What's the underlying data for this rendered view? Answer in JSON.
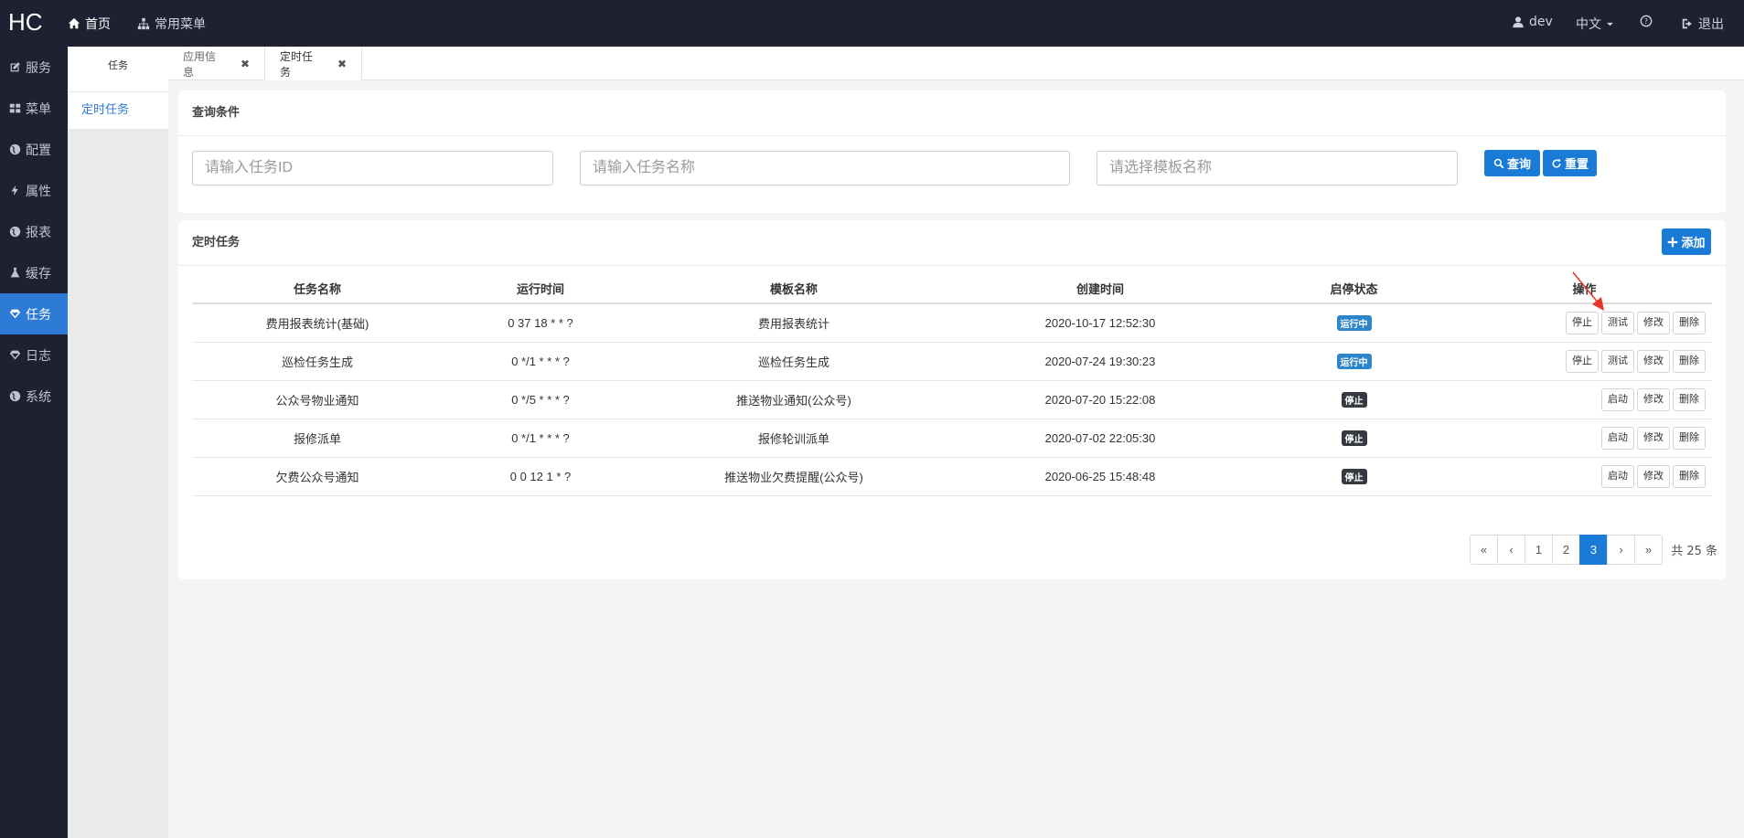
{
  "brand": "HC",
  "topnav": {
    "home": "首页",
    "common_menu": "常用菜单",
    "user": "dev",
    "language": "中文",
    "logout": "退出"
  },
  "sidebar": {
    "items": [
      {
        "label": "服务",
        "icon": "edit-icon"
      },
      {
        "label": "菜单",
        "icon": "grid-icon"
      },
      {
        "label": "配置",
        "icon": "globe-icon"
      },
      {
        "label": "属性",
        "icon": "bolt-icon"
      },
      {
        "label": "报表",
        "icon": "globe-icon"
      },
      {
        "label": "缓存",
        "icon": "flask-icon"
      },
      {
        "label": "任务",
        "icon": "diamond-icon"
      },
      {
        "label": "日志",
        "icon": "diamond-icon"
      },
      {
        "label": "系统",
        "icon": "globe-icon"
      }
    ],
    "active_index": 6
  },
  "subsidebar": {
    "title": "任务",
    "items": [
      "定时任务"
    ]
  },
  "tabs": [
    {
      "label": "应用信息"
    },
    {
      "label": "定时任务"
    }
  ],
  "query": {
    "title": "查询条件",
    "task_id_placeholder": "请输入任务ID",
    "task_name_placeholder": "请输入任务名称",
    "template_placeholder": "请选择模板名称",
    "search_label": "查询",
    "reset_label": "重置"
  },
  "task_panel": {
    "title": "定时任务",
    "add_label": "添加",
    "columns": [
      "任务名称",
      "运行时间",
      "模板名称",
      "创建时间",
      "启停状态",
      "操作"
    ],
    "rows": [
      {
        "name": "费用报表统计(基础)",
        "cron": "0 37 18 * * ?",
        "template": "费用报表统计",
        "created": "2020-10-17 12:52:30",
        "status": "运行中",
        "running": true,
        "ops": [
          "停止",
          "测试",
          "修改",
          "删除"
        ]
      },
      {
        "name": "巡检任务生成",
        "cron": "0 */1 * * * ?",
        "template": "巡检任务生成",
        "created": "2020-07-24 19:30:23",
        "status": "运行中",
        "running": true,
        "ops": [
          "停止",
          "测试",
          "修改",
          "删除"
        ]
      },
      {
        "name": "公众号物业通知",
        "cron": "0 */5 * * * ?",
        "template": "推送物业通知(公众号)",
        "created": "2020-07-20 15:22:08",
        "status": "停止",
        "running": false,
        "ops": [
          "启动",
          "修改",
          "删除"
        ]
      },
      {
        "name": "报修派单",
        "cron": "0 */1 * * * ?",
        "template": "报修轮训派单",
        "created": "2020-07-02 22:05:30",
        "status": "停止",
        "running": false,
        "ops": [
          "启动",
          "修改",
          "删除"
        ]
      },
      {
        "name": "欠费公众号通知",
        "cron": "0 0 12 1 * ?",
        "template": "推送物业欠费提醒(公众号)",
        "created": "2020-06-25 15:48:48",
        "status": "停止",
        "running": false,
        "ops": [
          "启动",
          "修改",
          "删除"
        ]
      }
    ]
  },
  "pagination": {
    "first": "«",
    "prev": "‹",
    "pages": [
      "1",
      "2",
      "3"
    ],
    "current": "3",
    "next": "›",
    "last": "»",
    "total": "共 25 条"
  },
  "colors": {
    "navbar": "#1e2132",
    "accent": "#1a7bd6",
    "running_badge": "#2d86c9",
    "stopped_badge": "#343a40",
    "annotation_arrow": "#e8332a"
  }
}
